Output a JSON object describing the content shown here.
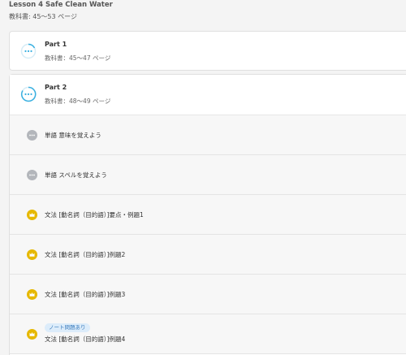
{
  "lesson": {
    "title": "Lesson 4 Safe Clean Water",
    "pages": "教科書: 45〜53 ページ"
  },
  "parts": [
    {
      "name": "Part 1",
      "pages": "教科書：45〜47 ページ"
    },
    {
      "name": "Part 2",
      "pages": "教科書：48〜49 ページ"
    }
  ],
  "items": [
    {
      "label": "単語 意味を覚えよう",
      "icon": "dots-icon"
    },
    {
      "label": "単語 スペルを覚えよう",
      "icon": "dots-icon"
    },
    {
      "label": "文法 [動名詞（目的語）]要点・例題1",
      "icon": "crown-icon"
    },
    {
      "label": "文法 [動名詞（目的語）]例題2",
      "icon": "crown-icon"
    },
    {
      "label": "文法 [動名詞（目的語）]例題3",
      "icon": "crown-icon"
    },
    {
      "label": "文法 [動名詞（目的語）]例題4",
      "icon": "crown-icon",
      "tag": "ノート問題あり"
    }
  ],
  "colors": {
    "progress_ring": "#3ab0e0",
    "dots_icon": "#b3b6bb",
    "crown_icon": "#e6b800",
    "tag_bg": "#dcecfa",
    "tag_text": "#3f7fbf"
  }
}
